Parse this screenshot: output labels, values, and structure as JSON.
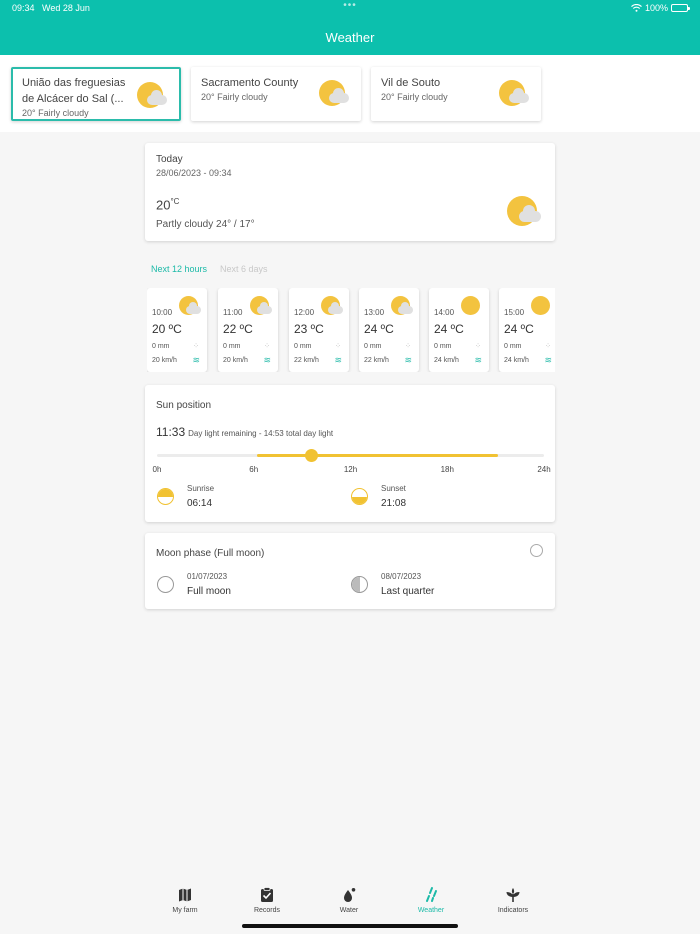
{
  "status": {
    "time": "09:34",
    "date": "Wed 28 Jun",
    "battery": "100%"
  },
  "header": {
    "title": "Weather"
  },
  "locations": [
    {
      "name": "União das freguesias de Alcácer do Sal (...",
      "sub": "20° Fairly cloudy",
      "active": true
    },
    {
      "name": "Sacramento County",
      "sub": "20° Fairly cloudy",
      "active": false
    },
    {
      "name": "Vil de Souto",
      "sub": "20° Fairly cloudy",
      "active": false
    }
  ],
  "today": {
    "label": "Today",
    "datetime": "28/06/2023 - 09:34",
    "temp": "20",
    "unit": "°C",
    "desc": "Partly cloudy 24° / 17°"
  },
  "tabs": {
    "next_hours": "Next 12 hours",
    "next_days": "Next 6 days"
  },
  "hours": [
    {
      "time": "10:00",
      "temp": "20 ºC",
      "rain": "0 mm",
      "wind": "20 km/h",
      "cloudy": true
    },
    {
      "time": "11:00",
      "temp": "22 ºC",
      "rain": "0 mm",
      "wind": "20 km/h",
      "cloudy": true
    },
    {
      "time": "12:00",
      "temp": "23 ºC",
      "rain": "0 mm",
      "wind": "22 km/h",
      "cloudy": true
    },
    {
      "time": "13:00",
      "temp": "24 ºC",
      "rain": "0 mm",
      "wind": "22 km/h",
      "cloudy": true
    },
    {
      "time": "14:00",
      "temp": "24 ºC",
      "rain": "0 mm",
      "wind": "24 km/h",
      "cloudy": false
    },
    {
      "time": "15:00",
      "temp": "24 ºC",
      "rain": "0 mm",
      "wind": "24 km/h",
      "cloudy": false
    }
  ],
  "sun": {
    "label": "Sun position",
    "remaining_time": "11:33",
    "remaining_text": "Day light remaining - 14:53 total day light",
    "ticks": [
      "0h",
      "6h",
      "12h",
      "18h",
      "24h"
    ],
    "sunrise_hours": 6.23,
    "sunset_hours": 21.13,
    "current_hours": 9.57,
    "sunrise_label": "Sunrise",
    "sunrise_time": "06:14",
    "sunset_label": "Sunset",
    "sunset_time": "21:08"
  },
  "moon": {
    "label": "Moon phase (Full moon)",
    "events": [
      {
        "date": "01/07/2023",
        "name": "Full moon",
        "phase": "full"
      },
      {
        "date": "08/07/2023",
        "name": "Last quarter",
        "phase": "last-quarter"
      }
    ]
  },
  "nav": [
    {
      "label": "My farm",
      "icon": "map-icon",
      "active": false
    },
    {
      "label": "Records",
      "icon": "clipboard-check-icon",
      "active": false
    },
    {
      "label": "Water",
      "icon": "water-drop-icon",
      "active": false
    },
    {
      "label": "Weather",
      "icon": "weather-icon",
      "active": true
    },
    {
      "label": "Indicators",
      "icon": "sprout-icon",
      "active": false
    }
  ],
  "colors": {
    "accent": "#0cc0ad",
    "sun": "#f3c33f",
    "cloud": "#e0e0e0"
  }
}
